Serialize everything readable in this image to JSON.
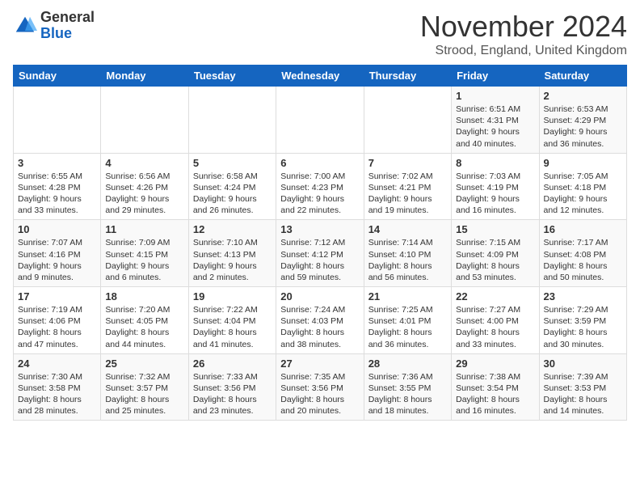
{
  "logo": {
    "general": "General",
    "blue": "Blue"
  },
  "header": {
    "month_title": "November 2024",
    "subtitle": "Strood, England, United Kingdom"
  },
  "weekdays": [
    "Sunday",
    "Monday",
    "Tuesday",
    "Wednesday",
    "Thursday",
    "Friday",
    "Saturday"
  ],
  "weeks": [
    [
      {
        "day": "",
        "info": ""
      },
      {
        "day": "",
        "info": ""
      },
      {
        "day": "",
        "info": ""
      },
      {
        "day": "",
        "info": ""
      },
      {
        "day": "",
        "info": ""
      },
      {
        "day": "1",
        "info": "Sunrise: 6:51 AM\nSunset: 4:31 PM\nDaylight: 9 hours\nand 40 minutes."
      },
      {
        "day": "2",
        "info": "Sunrise: 6:53 AM\nSunset: 4:29 PM\nDaylight: 9 hours\nand 36 minutes."
      }
    ],
    [
      {
        "day": "3",
        "info": "Sunrise: 6:55 AM\nSunset: 4:28 PM\nDaylight: 9 hours\nand 33 minutes."
      },
      {
        "day": "4",
        "info": "Sunrise: 6:56 AM\nSunset: 4:26 PM\nDaylight: 9 hours\nand 29 minutes."
      },
      {
        "day": "5",
        "info": "Sunrise: 6:58 AM\nSunset: 4:24 PM\nDaylight: 9 hours\nand 26 minutes."
      },
      {
        "day": "6",
        "info": "Sunrise: 7:00 AM\nSunset: 4:23 PM\nDaylight: 9 hours\nand 22 minutes."
      },
      {
        "day": "7",
        "info": "Sunrise: 7:02 AM\nSunset: 4:21 PM\nDaylight: 9 hours\nand 19 minutes."
      },
      {
        "day": "8",
        "info": "Sunrise: 7:03 AM\nSunset: 4:19 PM\nDaylight: 9 hours\nand 16 minutes."
      },
      {
        "day": "9",
        "info": "Sunrise: 7:05 AM\nSunset: 4:18 PM\nDaylight: 9 hours\nand 12 minutes."
      }
    ],
    [
      {
        "day": "10",
        "info": "Sunrise: 7:07 AM\nSunset: 4:16 PM\nDaylight: 9 hours\nand 9 minutes."
      },
      {
        "day": "11",
        "info": "Sunrise: 7:09 AM\nSunset: 4:15 PM\nDaylight: 9 hours\nand 6 minutes."
      },
      {
        "day": "12",
        "info": "Sunrise: 7:10 AM\nSunset: 4:13 PM\nDaylight: 9 hours\nand 2 minutes."
      },
      {
        "day": "13",
        "info": "Sunrise: 7:12 AM\nSunset: 4:12 PM\nDaylight: 8 hours\nand 59 minutes."
      },
      {
        "day": "14",
        "info": "Sunrise: 7:14 AM\nSunset: 4:10 PM\nDaylight: 8 hours\nand 56 minutes."
      },
      {
        "day": "15",
        "info": "Sunrise: 7:15 AM\nSunset: 4:09 PM\nDaylight: 8 hours\nand 53 minutes."
      },
      {
        "day": "16",
        "info": "Sunrise: 7:17 AM\nSunset: 4:08 PM\nDaylight: 8 hours\nand 50 minutes."
      }
    ],
    [
      {
        "day": "17",
        "info": "Sunrise: 7:19 AM\nSunset: 4:06 PM\nDaylight: 8 hours\nand 47 minutes."
      },
      {
        "day": "18",
        "info": "Sunrise: 7:20 AM\nSunset: 4:05 PM\nDaylight: 8 hours\nand 44 minutes."
      },
      {
        "day": "19",
        "info": "Sunrise: 7:22 AM\nSunset: 4:04 PM\nDaylight: 8 hours\nand 41 minutes."
      },
      {
        "day": "20",
        "info": "Sunrise: 7:24 AM\nSunset: 4:03 PM\nDaylight: 8 hours\nand 38 minutes."
      },
      {
        "day": "21",
        "info": "Sunrise: 7:25 AM\nSunset: 4:01 PM\nDaylight: 8 hours\nand 36 minutes."
      },
      {
        "day": "22",
        "info": "Sunrise: 7:27 AM\nSunset: 4:00 PM\nDaylight: 8 hours\nand 33 minutes."
      },
      {
        "day": "23",
        "info": "Sunrise: 7:29 AM\nSunset: 3:59 PM\nDaylight: 8 hours\nand 30 minutes."
      }
    ],
    [
      {
        "day": "24",
        "info": "Sunrise: 7:30 AM\nSunset: 3:58 PM\nDaylight: 8 hours\nand 28 minutes."
      },
      {
        "day": "25",
        "info": "Sunrise: 7:32 AM\nSunset: 3:57 PM\nDaylight: 8 hours\nand 25 minutes."
      },
      {
        "day": "26",
        "info": "Sunrise: 7:33 AM\nSunset: 3:56 PM\nDaylight: 8 hours\nand 23 minutes."
      },
      {
        "day": "27",
        "info": "Sunrise: 7:35 AM\nSunset: 3:56 PM\nDaylight: 8 hours\nand 20 minutes."
      },
      {
        "day": "28",
        "info": "Sunrise: 7:36 AM\nSunset: 3:55 PM\nDaylight: 8 hours\nand 18 minutes."
      },
      {
        "day": "29",
        "info": "Sunrise: 7:38 AM\nSunset: 3:54 PM\nDaylight: 8 hours\nand 16 minutes."
      },
      {
        "day": "30",
        "info": "Sunrise: 7:39 AM\nSunset: 3:53 PM\nDaylight: 8 hours\nand 14 minutes."
      }
    ]
  ]
}
